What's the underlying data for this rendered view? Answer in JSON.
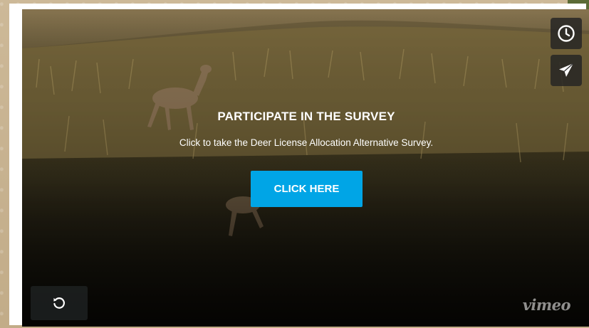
{
  "survey": {
    "title": "PARTICIPATE IN THE SURVEY",
    "subtitle": "Click to take the Deer License Allocation Alternative Survey.",
    "button_label": "CLICK HERE"
  },
  "controls": {
    "watch_later_icon": "clock-icon",
    "share_icon": "paper-plane-icon",
    "replay_icon": "replay-icon"
  },
  "branding": {
    "logo": "vimeo"
  },
  "colors": {
    "cta": "#00a5e6",
    "page_background": "#c7b290",
    "corner_accent": "#5b6b36"
  }
}
